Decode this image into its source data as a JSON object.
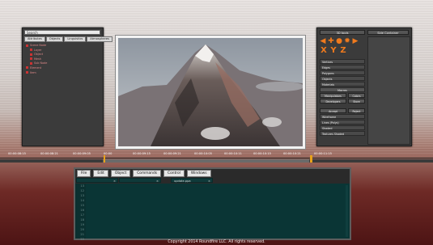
{
  "left_panel": {
    "search_label": "Search",
    "tabs": [
      "Attributes",
      "Objects",
      "Linguistics",
      "Atmospheres"
    ],
    "tree": [
      {
        "label": "Scene Node",
        "level": 0
      },
      {
        "label": "Layer",
        "level": 1
      },
      {
        "label": "Object",
        "level": 1
      },
      {
        "label": "Mesh",
        "level": 1
      },
      {
        "label": "Sub Node",
        "level": 1
      },
      {
        "label": "Element",
        "level": 0
      },
      {
        "label": "Item",
        "level": 0
      }
    ]
  },
  "right_panel": {
    "header_left": "3D tools",
    "header_right": "Side Container",
    "xyz": [
      "X",
      "Y",
      "Z"
    ],
    "list_items": [
      "Vertices",
      "Edges",
      "Polygons",
      "Objects",
      "Materials"
    ],
    "section_title": "Macros",
    "buttons_row1": [
      "Manipulators",
      "Colors"
    ],
    "buttons_row2": [
      "Developers",
      "Store"
    ],
    "buttons_row3": [
      "Accept",
      "Reject"
    ],
    "modes": [
      "Wireframe",
      "Lines (Polys)",
      "Shaded",
      "Textures Shaded"
    ]
  },
  "timeline": {
    "tick_labels": [
      "00:00:08:15",
      "00:00:08:21",
      "00:00:09:05",
      "00:00",
      "00:00:09:15",
      "00:00:09:21",
      "00:00:10:05",
      "00:00:10:11",
      "00:00:10:15",
      "00:00:10:21",
      "00:00:11:15"
    ],
    "progress": 0.48
  },
  "editor": {
    "menu": [
      "File",
      "Edit",
      "Object",
      "Commands",
      "Control",
      "Windows"
    ],
    "tabs": [
      "",
      "",
      "update.ppa"
    ],
    "line_numbers": [
      "13",
      "12",
      "13",
      "14",
      "15",
      "16",
      "17",
      "18",
      "19",
      "20",
      "21",
      "22"
    ]
  },
  "footer": {
    "copyright": "Copyright 2014 Roundfire LLC. All rights reserved."
  },
  "colors": {
    "accent": "#f07a1d",
    "code_bg": "#0a3535",
    "panel_bg": "#3b3b3b"
  }
}
